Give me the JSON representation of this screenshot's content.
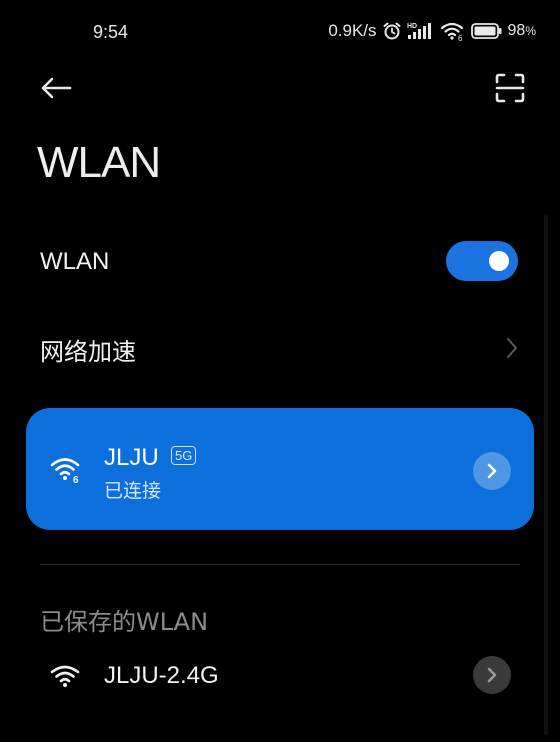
{
  "status_bar": {
    "time": "9:54",
    "speed": "0.9K/s",
    "battery_percent": "98",
    "battery_unit": "%",
    "icons": [
      "alarm-icon",
      "hd-signal-icon",
      "wifi-6-icon",
      "battery-icon"
    ]
  },
  "header": {
    "back_icon": "arrow-left-icon",
    "scan_icon": "qr-scan-icon",
    "title": "WLAN"
  },
  "wlan_toggle": {
    "label": "WLAN",
    "enabled": true
  },
  "network_acceleration": {
    "label": "网络加速"
  },
  "connected_network": {
    "ssid": "JLJU",
    "band_badge": "5G",
    "status": "已连接",
    "wifi_icon": "wifi-6-icon",
    "detail_icon": "chevron-right-icon"
  },
  "saved_networks": {
    "section_title": "已保存的WLAN",
    "items": [
      {
        "ssid": "JLJU-2.4G",
        "icon": "wifi-icon"
      }
    ]
  },
  "colors": {
    "background": "#000000",
    "accent": "#0d6fdc",
    "toggle_on": "#1a73e0",
    "secondary_text": "#8c8c8c"
  }
}
